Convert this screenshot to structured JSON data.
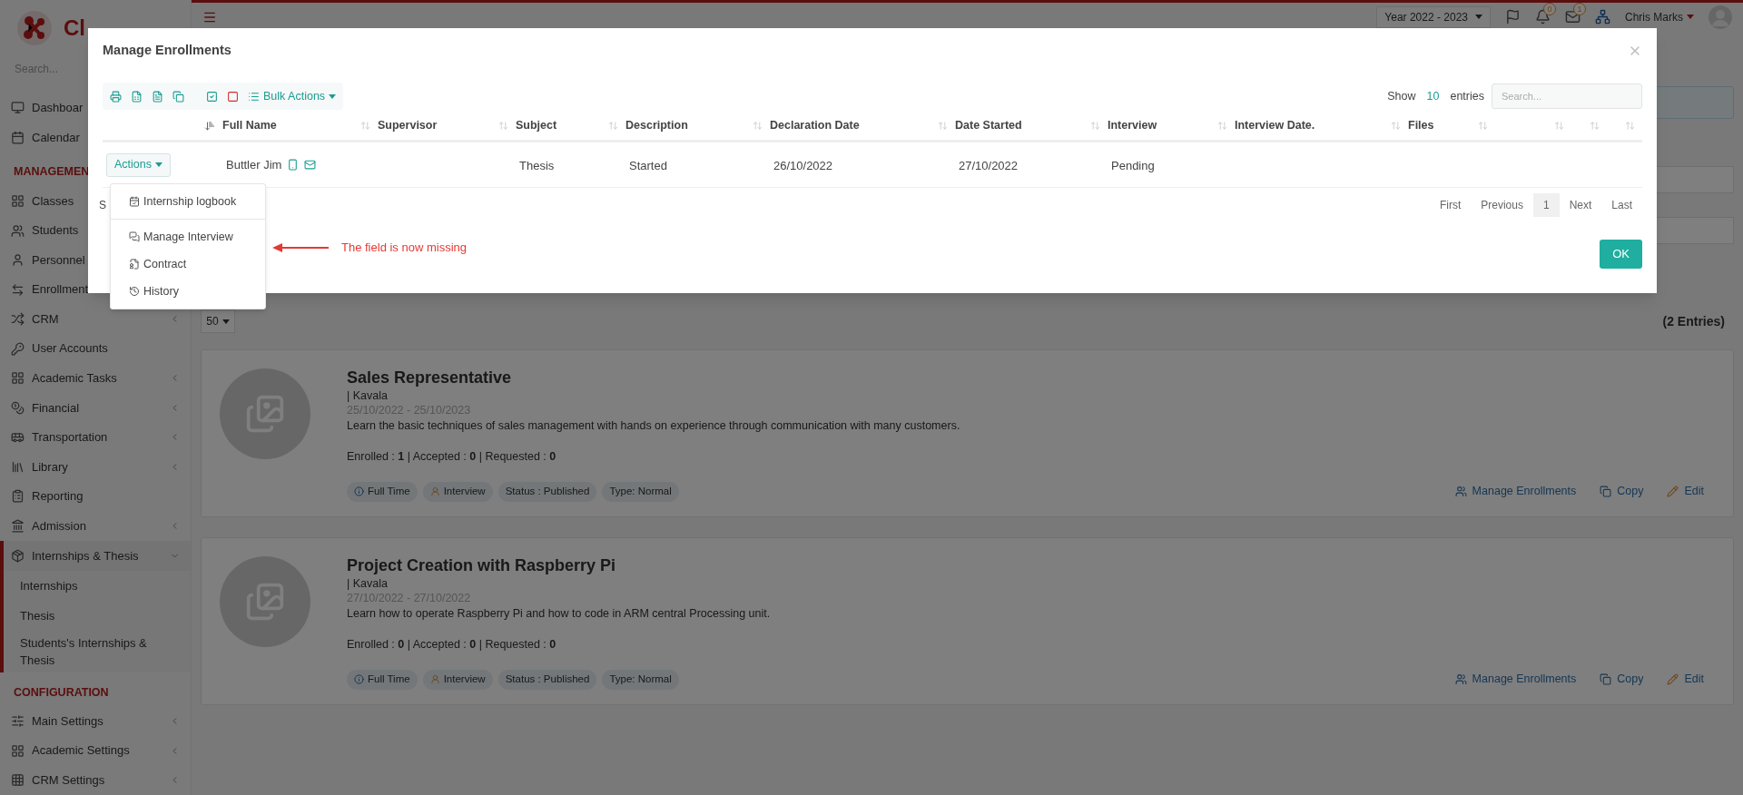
{
  "sidebar": {
    "brand": "Cl",
    "search": {
      "placeholder": "Search..."
    },
    "items": [
      {
        "kind": "link",
        "label": "Dashboar"
      },
      {
        "kind": "link",
        "label": "Calendar"
      },
      {
        "kind": "heading",
        "label": "MANAGEMEN"
      },
      {
        "kind": "link",
        "label": "Classes"
      },
      {
        "kind": "link",
        "label": "Students"
      },
      {
        "kind": "link",
        "label": "Personnel"
      },
      {
        "kind": "link",
        "label": "Enrollment"
      },
      {
        "kind": "link",
        "label": "CRM",
        "submenu": true
      },
      {
        "kind": "link",
        "label": "User Accounts",
        "submenu": false
      },
      {
        "kind": "link",
        "label": "Academic Tasks",
        "submenu": true
      },
      {
        "kind": "link",
        "label": "Financial",
        "submenu": true
      },
      {
        "kind": "link",
        "label": "Transportation",
        "submenu": true
      },
      {
        "kind": "link",
        "label": "Library",
        "submenu": true
      },
      {
        "kind": "link",
        "label": "Reporting",
        "submenu": false
      },
      {
        "kind": "link",
        "label": "Admission",
        "submenu": true
      },
      {
        "kind": "group",
        "label": "Internships & Thesis",
        "expanded": true,
        "selected": true,
        "children": [
          {
            "label": "Internships"
          },
          {
            "label": "Thesis"
          },
          {
            "label": "Students's Internships & Thesis"
          }
        ]
      },
      {
        "kind": "heading",
        "label": "CONFIGURATION"
      },
      {
        "kind": "link",
        "label": "Main Settings",
        "submenu": true
      },
      {
        "kind": "link",
        "label": "Academic Settings",
        "submenu": true
      },
      {
        "kind": "link",
        "label": "CRM Settings",
        "submenu": true
      }
    ]
  },
  "header": {
    "year_select": "Year 2022 - 2023",
    "notifications_count": "0",
    "messages_count": "1",
    "user_name": "Chris Marks"
  },
  "main": {
    "page_length": "50",
    "entries_count": "(2 Entries)",
    "cards": [
      {
        "title": "Sales Representative",
        "location": "| Kavala",
        "dates": "25/10/2022 - 25/10/2023",
        "description": "Learn the basic techniques of sales management with hands on experience through communication with many customers.",
        "stats": "Enrolled : **1** | Accepted : **0** | Requested : **0**",
        "tags": [
          {
            "kind": "info",
            "label": "Full Time"
          },
          {
            "kind": "person",
            "label": "Interview"
          },
          {
            "kind": "plain",
            "label": "Status : Published"
          },
          {
            "kind": "plain",
            "label": "Type: Normal"
          }
        ],
        "actions": [
          {
            "kind": "users",
            "label": "Manage Enrollments"
          },
          {
            "kind": "copy",
            "label": "Copy"
          },
          {
            "kind": "edit",
            "label": "Edit"
          }
        ]
      },
      {
        "title": "Project Creation with Raspberry Pi",
        "location": "| Kavala",
        "dates": "27/10/2022 - 27/10/2022",
        "description": "Learn how to operate Raspberry Pi and how to code in ARM central Processing unit.",
        "stats": "Enrolled : **0** | Accepted : **0** | Requested : **0**",
        "tags": [
          {
            "kind": "info",
            "label": "Full Time"
          },
          {
            "kind": "person",
            "label": "Interview"
          },
          {
            "kind": "plain",
            "label": "Status : Published"
          },
          {
            "kind": "plain",
            "label": "Type: Normal"
          }
        ],
        "actions": [
          {
            "kind": "users",
            "label": "Manage Enrollments"
          },
          {
            "kind": "copy",
            "label": "Copy"
          },
          {
            "kind": "edit",
            "label": "Edit"
          }
        ]
      }
    ]
  },
  "modal": {
    "title": "Manage Enrollments",
    "bulk_actions": "Bulk Actions",
    "length": {
      "before": "Show",
      "value": "10",
      "after": "entries"
    },
    "search": {
      "placeholder": "Search..."
    },
    "table": {
      "columns": [
        {
          "sorted": true
        },
        {
          "label": "Full Name",
          "sorted": false
        },
        {
          "label": "Supervisor",
          "sorted": false
        },
        {
          "label": "Subject",
          "sorted": false
        },
        {
          "label": "Description",
          "sorted": false
        },
        {
          "label": "Declaration Date",
          "sorted": false
        },
        {
          "label": "Date Started",
          "sorted": false
        },
        {
          "label": "Interview",
          "sorted": false
        },
        {
          "label": "Interview Date.",
          "sorted": false
        },
        {
          "label": "Files",
          "sorted": false
        },
        {
          "sorted": false
        },
        {
          "sorted": false
        },
        {
          "sorted": false
        }
      ],
      "rows": [
        {
          "cells": [
            {
              "kind": "actions",
              "label": "Actions"
            },
            {
              "kind": "person",
              "text": "Buttler Jim"
            },
            {
              "kind": "empty"
            },
            {
              "kind": "text",
              "text": "Thesis"
            },
            {
              "kind": "text",
              "text": "Started"
            },
            {
              "kind": "text",
              "text": "26/10/2022"
            },
            {
              "kind": "text",
              "text": "27/10/2022"
            },
            {
              "kind": "text",
              "text": "Pending"
            }
          ]
        }
      ]
    },
    "actions_menu": {
      "open": true,
      "groups": [
        [
          {
            "kind": "logbook",
            "label": "Internship logbook"
          }
        ],
        [
          {
            "kind": "interview",
            "label": "Manage Interview"
          },
          {
            "kind": "contract",
            "label": "Contract"
          },
          {
            "kind": "history",
            "label": "History"
          }
        ]
      ]
    },
    "info": "S",
    "pagination": [
      {
        "label": "First",
        "selected": false
      },
      {
        "label": "Previous",
        "selected": false
      },
      {
        "label": "1",
        "selected": true
      },
      {
        "label": "Next",
        "selected": false
      },
      {
        "label": "Last",
        "selected": false
      }
    ],
    "annotation": "The field is now missing",
    "ok_button": "OK"
  }
}
